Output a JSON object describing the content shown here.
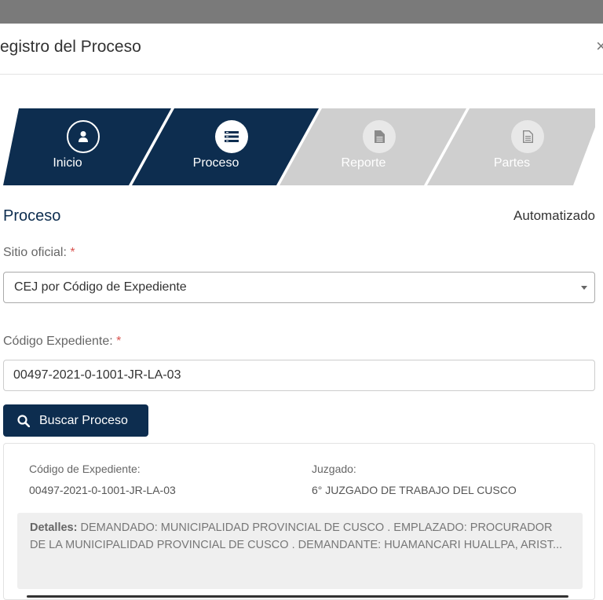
{
  "modal": {
    "title": "egistro del Proceso",
    "close_label": "×"
  },
  "steps": [
    {
      "label": "Inicio",
      "icon": "user-icon",
      "active": true
    },
    {
      "label": "Proceso",
      "icon": "list-icon",
      "active": true
    },
    {
      "label": "Reporte",
      "icon": "document-icon",
      "active": false
    },
    {
      "label": "Partes",
      "icon": "document-lines-icon",
      "active": false
    }
  ],
  "section": {
    "title": "Proceso",
    "mode": "Automatizado"
  },
  "form": {
    "sitio_label": "Sitio oficial:",
    "sitio_value": "CEJ por Código de Expediente",
    "codigo_label": "Código Expediente:",
    "codigo_value": "00497-2021-0-1001-JR-LA-03",
    "required_mark": "*"
  },
  "search_button": {
    "label": "Buscar Proceso"
  },
  "result": {
    "codigo_label": "Código de Expediente:",
    "codigo_value": "00497-2021-0-1001-JR-LA-03",
    "juzgado_label": "Juzgado:",
    "juzgado_value": "6° JUZGADO DE TRABAJO DEL CUSCO",
    "details_label": "Detalles:",
    "details_text": "DEMANDADO: MUNICIPALIDAD PROVINCIAL DE CUSCO . EMPLAZADO: PROCURADOR DE LA MUNICIPALIDAD PROVINCIAL DE CUSCO . DEMANDANTE: HUAMANCARI HUALLPA, ARIST..."
  },
  "colors": {
    "primary": "#0d2d4f",
    "inactive_step": "#cfcfcf",
    "required": "#d9534f"
  }
}
